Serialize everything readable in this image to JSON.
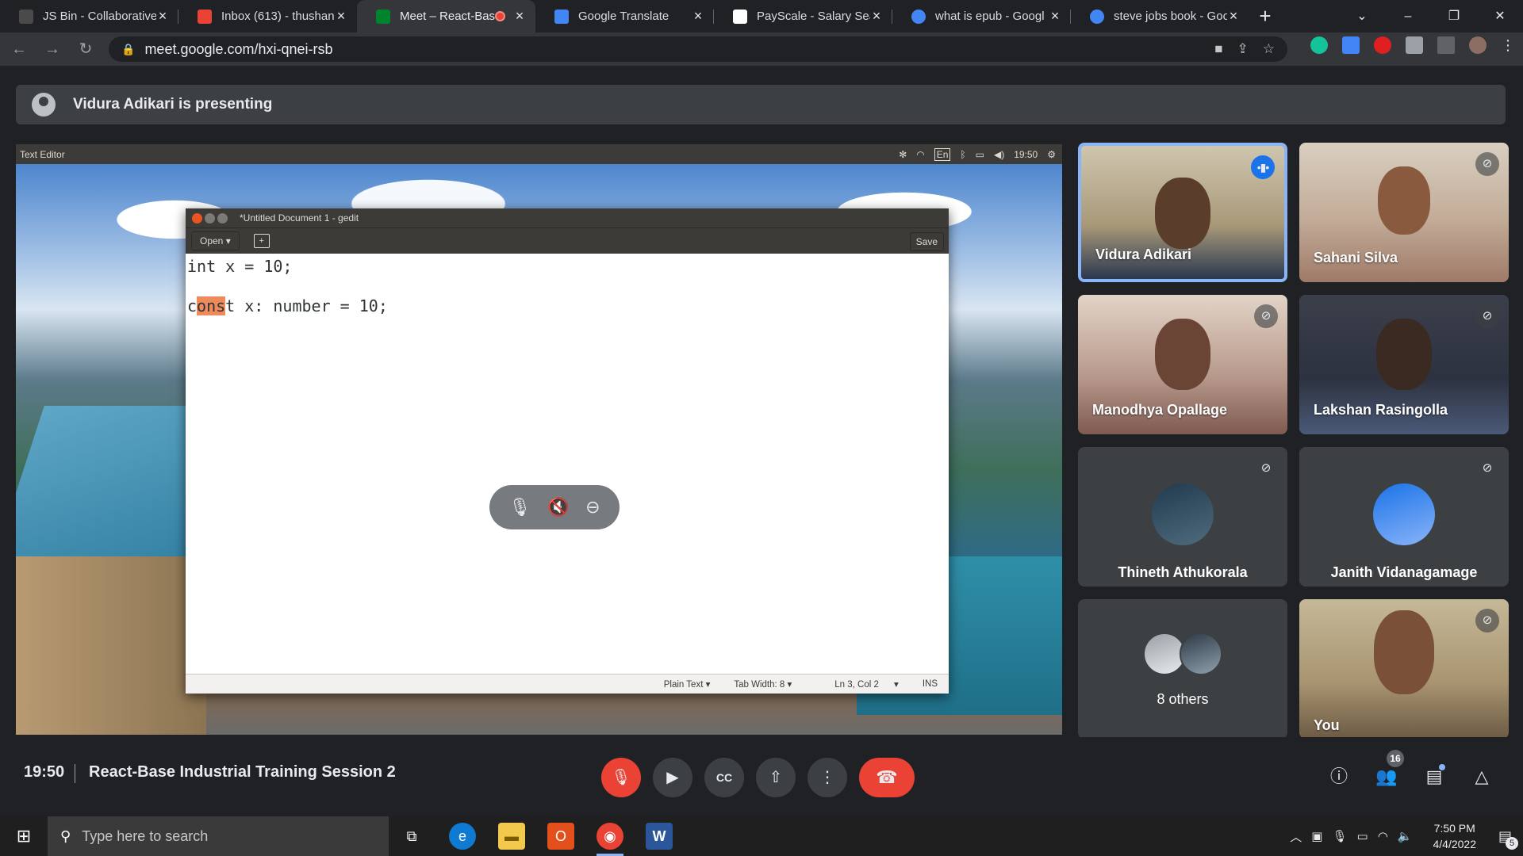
{
  "browser": {
    "tabs": [
      {
        "label": "JS Bin - Collaborative",
        "favicon_color": "#4a4a4a"
      },
      {
        "label": "Inbox (613) - thushan",
        "favicon_color": "#ea4335"
      },
      {
        "label": "Meet – React-Bas",
        "favicon_color": "#00832d",
        "recording": true
      },
      {
        "label": "Google Translate",
        "favicon_color": "#4285f4"
      },
      {
        "label": "PayScale - Salary Sear",
        "favicon_color": "#ffffff"
      },
      {
        "label": "what is epub - Googl",
        "favicon_color": "#4285f4"
      },
      {
        "label": "steve jobs book - Goo",
        "favicon_color": "#4285f4"
      }
    ],
    "active_tab_index": 2,
    "url": "meet.google.com/hxi-qnei-rsb"
  },
  "meet": {
    "presenting_banner": "Vidura Adikari is presenting",
    "shared_screen": {
      "topbar_title": "Text Editor",
      "topbar_lang": "En",
      "topbar_time": "19:50",
      "gedit": {
        "title": "*Untitled Document 1 - gedit",
        "open_label": "Open",
        "save_label": "Save",
        "line1": "int x = 10;",
        "line3_pre": "c",
        "line3_hl": "ons",
        "line3_post": "t x: number = 10;",
        "status": {
          "syntax": "Plain Text",
          "tab_width": "Tab Width: 8",
          "position": "Ln 3, Col 2",
          "mode": "INS"
        }
      }
    },
    "participants": [
      {
        "name": "Vidura Adikari",
        "speaking": true,
        "video": true,
        "bg": "#6b5a3f"
      },
      {
        "name": "Sahani Silva",
        "muted": true,
        "video": true,
        "bg": "#c9b8a4"
      },
      {
        "name": "Manodhya Opallage",
        "muted": true,
        "video": true,
        "bg": "#b79e8e"
      },
      {
        "name": "Lakshan Rasingolla",
        "muted": true,
        "video": true,
        "bg": "#3e4555"
      },
      {
        "name": "Thineth Athukorala",
        "muted": true,
        "video": false
      },
      {
        "name": "Janith Vidanagamage",
        "muted": true,
        "video": false
      },
      {
        "name": "8 others",
        "video": false
      },
      {
        "name": "You",
        "muted": true,
        "video": true,
        "bg": "#b8a98a"
      }
    ],
    "bottom": {
      "time": "19:50",
      "meeting_name": "React-Base Industrial Training Session 2",
      "people_count": "16"
    }
  },
  "taskbar": {
    "search_placeholder": "Type here to search",
    "time": "7:50 PM",
    "date": "4/4/2022",
    "notifications": "5"
  }
}
